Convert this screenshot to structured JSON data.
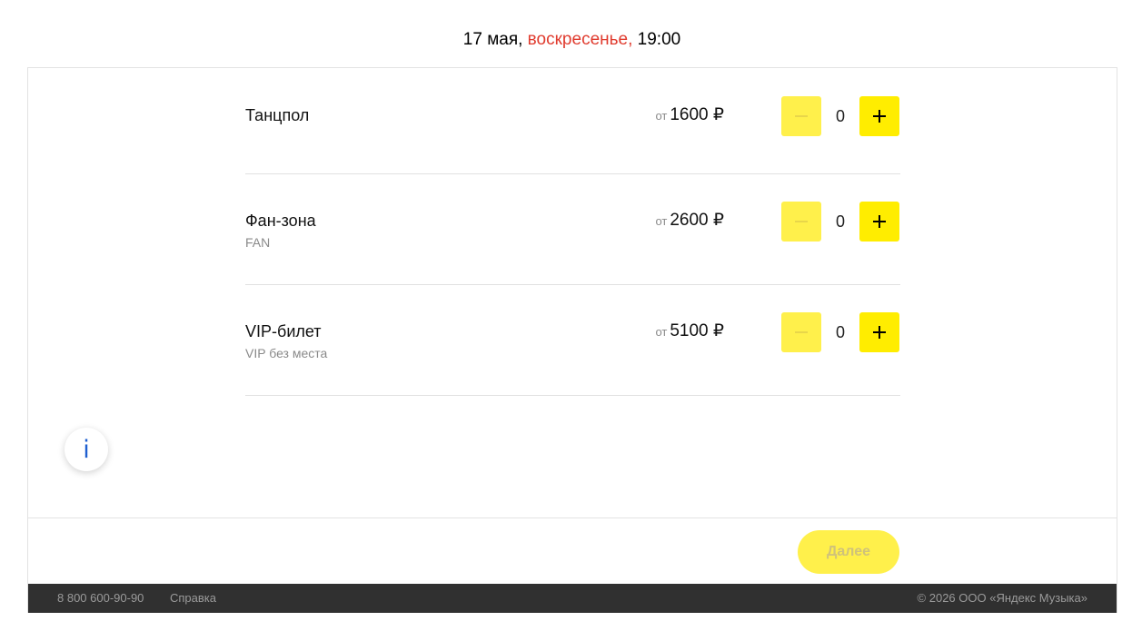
{
  "header": {
    "date": "17 мая,",
    "weekday": "воскресенье,",
    "time": "19:00"
  },
  "tickets": [
    {
      "name": "Танцпол",
      "subtitle": "",
      "price_prefix": "от",
      "price": "1600 ₽",
      "count": "0"
    },
    {
      "name": "Фан-зона",
      "subtitle": "FAN",
      "price_prefix": "от",
      "price": "2600 ₽",
      "count": "0"
    },
    {
      "name": "VIP-билет",
      "subtitle": "VIP без места",
      "price_prefix": "от",
      "price": "5100 ₽",
      "count": "0"
    }
  ],
  "icons": {
    "info": "info-icon",
    "minus": "minus-icon",
    "plus": "plus-icon"
  },
  "actions": {
    "next_label": "Далее"
  },
  "footer": {
    "phone": "8 800 600-90-90",
    "help": "Справка",
    "copyright": "© 2026 ООО «Яндекс Музыка»"
  },
  "colors": {
    "accent_yellow": "#ffed00",
    "accent_yellow_disabled": "#fff04b",
    "weekday_red": "#e03b2e",
    "footer_bg": "#303030",
    "info_blue": "#1f5fd0"
  }
}
